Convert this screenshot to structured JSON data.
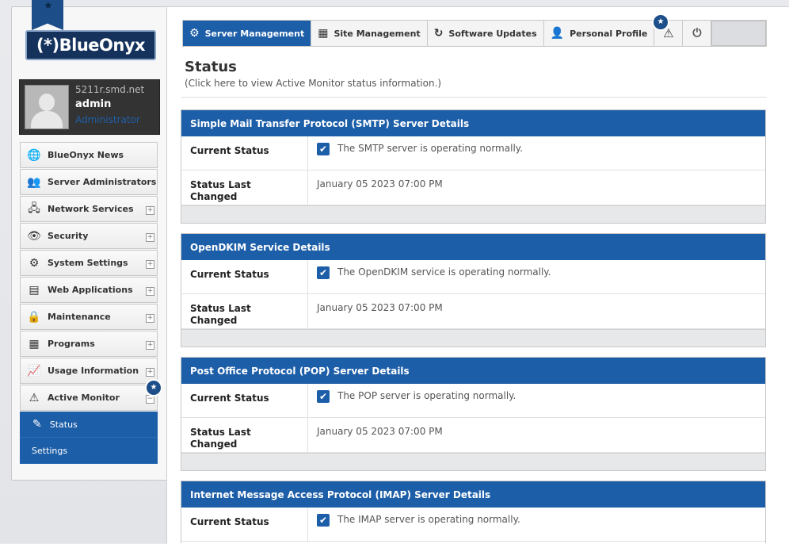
{
  "app": {
    "logo_text": "(*)BlueOnyx"
  },
  "user": {
    "host": "5211r.smd.net",
    "name": "admin",
    "role": "Administrator"
  },
  "sidebar": {
    "items": [
      {
        "label": "BlueOnyx News",
        "icon": "globe-icon",
        "glyph": "🌐",
        "expandable": false
      },
      {
        "label": "Server Administrators",
        "icon": "users-icon",
        "glyph": "👥",
        "expandable": false
      },
      {
        "label": "Network Services",
        "icon": "network-icon",
        "glyph": "🖧",
        "expandable": true
      },
      {
        "label": "Security",
        "icon": "eye-icon",
        "glyph": "👁",
        "expandable": true
      },
      {
        "label": "System Settings",
        "icon": "gear-icon",
        "glyph": "⚙",
        "expandable": true
      },
      {
        "label": "Web Applications",
        "icon": "server-icon",
        "glyph": "▤",
        "expandable": true
      },
      {
        "label": "Maintenance",
        "icon": "lock-icon",
        "glyph": "🔒",
        "expandable": true
      },
      {
        "label": "Programs",
        "icon": "chip-icon",
        "glyph": "▦",
        "expandable": true
      },
      {
        "label": "Usage Information",
        "icon": "chart-icon",
        "glyph": "📈",
        "expandable": true
      },
      {
        "label": "Active Monitor",
        "icon": "warning-icon",
        "glyph": "⚠",
        "expandable": true
      }
    ],
    "sub_items": [
      {
        "label": "Status",
        "glyph": "✎"
      },
      {
        "label": "Settings"
      }
    ],
    "badge": "★"
  },
  "tabs": [
    {
      "label": "Server Management",
      "icon": "gear-icon",
      "glyph": "⚙",
      "active": true
    },
    {
      "label": "Site Management",
      "icon": "grid-icon",
      "glyph": "▦",
      "active": false
    },
    {
      "label": "Software Updates",
      "icon": "refresh-icon",
      "glyph": "↻",
      "active": false
    },
    {
      "label": "Personal Profile",
      "icon": "person-icon",
      "glyph": "👤",
      "active": false
    }
  ],
  "tab_icons": {
    "warning": "⚠",
    "logout": "⏻",
    "badge": "★"
  },
  "page": {
    "title": "Status",
    "subtitle": "(Click here to view Active Monitor status information.)"
  },
  "cards": [
    {
      "title": "Simple Mail Transfer Protocol (SMTP) Server Details",
      "status_label": "Current Status",
      "status_text": "The SMTP server is operating normally.",
      "changed_label": "Status Last Changed",
      "changed_value": "January 05 2023 07:00 PM"
    },
    {
      "title": "OpenDKIM Service Details",
      "status_label": "Current Status",
      "status_text": "The OpenDKIM service is operating normally.",
      "changed_label": "Status Last Changed",
      "changed_value": "January 05 2023 07:00 PM"
    },
    {
      "title": "Post Office Protocol (POP) Server Details",
      "status_label": "Current Status",
      "status_text": "The POP server is operating normally.",
      "changed_label": "Status Last Changed",
      "changed_value": "January 05 2023 07:00 PM"
    },
    {
      "title": "Internet Message Access Protocol (IMAP) Server Details",
      "status_label": "Current Status",
      "status_text": "The IMAP server is operating normally."
    }
  ],
  "check_glyph": "✔",
  "expand_glyph": "+",
  "collapse_glyph": "−"
}
